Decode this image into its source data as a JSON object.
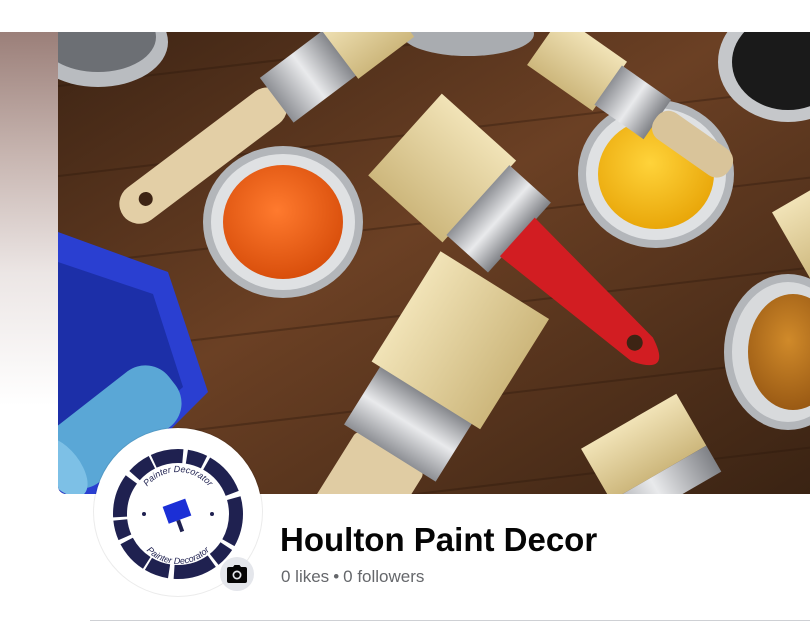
{
  "profile": {
    "name": "Houlton Paint Decor",
    "likes": "0 likes",
    "separator": "•",
    "followers": "0 followers"
  },
  "cover_photo": {
    "description_icon": "paint-brushes-and-paint-cans-photo"
  },
  "avatar": {
    "ring_text_top": "Painter Decorator",
    "ring_text_bottom": "Painter Decorator",
    "icon": "paint-roller-logo"
  },
  "camera_button": {
    "icon": "camera-icon"
  },
  "colors": {
    "name_text": "#050505",
    "secondary_text": "#65676b",
    "camera_bg": "#e4e6eb",
    "logo_navy": "#1f2150",
    "logo_blue": "#1b2fd6"
  }
}
